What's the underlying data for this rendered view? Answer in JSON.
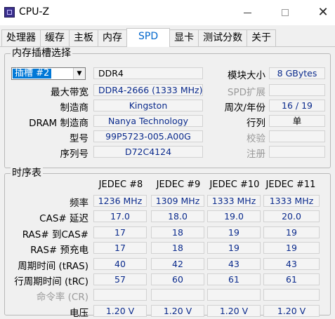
{
  "window": {
    "title": "CPU-Z"
  },
  "tabs": [
    {
      "label": "处理器"
    },
    {
      "label": "缓存"
    },
    {
      "label": "主板"
    },
    {
      "label": "内存"
    },
    {
      "label": "SPD"
    },
    {
      "label": "显卡"
    },
    {
      "label": "测试分数"
    },
    {
      "label": "关于"
    }
  ],
  "active_tab": "SPD",
  "slot": {
    "group_title": "内存插槽选择",
    "selected": "插槽 #2",
    "type": "DDR4",
    "max_bandwidth_label": "最大带宽",
    "max_bandwidth": "DDR4-2666 (1333 MHz)",
    "manufacturer_label": "制造商",
    "manufacturer": "Kingston",
    "dram_label": "DRAM 制造商",
    "dram_manufacturer": "Nanya Technology",
    "part_label": "型号",
    "part_number": "99P5723-005.A00G",
    "serial_label": "序列号",
    "serial": "D72C4124",
    "module_size_label": "模块大小",
    "module_size": "8 GBytes",
    "spd_ext_label": "SPD扩展",
    "spd_ext": "",
    "week_year_label": "周次/年份",
    "week_year": "16 / 19",
    "rank_label": "行列",
    "rank": "单",
    "correction_label": "校验",
    "correction": "",
    "registered_label": "注册",
    "registered": ""
  },
  "timings": {
    "group_title": "时序表",
    "columns": [
      "JEDEC #8",
      "JEDEC #9",
      "JEDEC #10",
      "JEDEC #11"
    ],
    "rows": [
      {
        "label": "频率",
        "values": [
          "1236 MHz",
          "1309 MHz",
          "1333 MHz",
          "1333 MHz"
        ],
        "dim": false
      },
      {
        "label": "CAS# 延迟",
        "values": [
          "17.0",
          "18.0",
          "19.0",
          "20.0"
        ],
        "dim": false
      },
      {
        "label": "RAS# 到CAS#",
        "values": [
          "17",
          "18",
          "19",
          "19"
        ],
        "dim": false
      },
      {
        "label": "RAS# 预充电",
        "values": [
          "17",
          "18",
          "19",
          "19"
        ],
        "dim": false
      },
      {
        "label": "周期时间 (tRAS)",
        "values": [
          "40",
          "42",
          "43",
          "43"
        ],
        "dim": false
      },
      {
        "label": "行周期时间 (tRC)",
        "values": [
          "57",
          "60",
          "61",
          "61"
        ],
        "dim": false
      },
      {
        "label": "命令率 (CR)",
        "values": [
          "",
          "",
          "",
          ""
        ],
        "dim": true
      },
      {
        "label": "电压",
        "values": [
          "1.20 V",
          "1.20 V",
          "1.20 V",
          "1.20 V"
        ],
        "dim": false
      }
    ]
  }
}
